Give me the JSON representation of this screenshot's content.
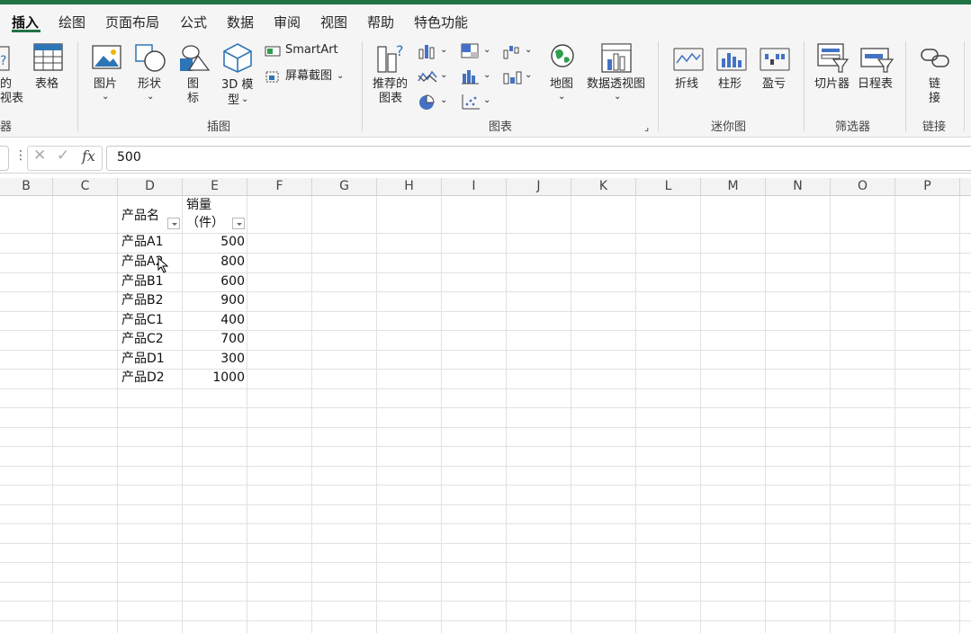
{
  "tabs": [
    "插入",
    "绘图",
    "页面布局",
    "公式",
    "数据",
    "审阅",
    "视图",
    "帮助",
    "特色功能"
  ],
  "ribbon": {
    "partial_left": {
      "line1": "的",
      "line2": "视表"
    },
    "table": "表格",
    "picture": "图片",
    "shapes": "形状",
    "icons_l1": "图",
    "icons_l2": "标",
    "model3d_l1": "3D 模",
    "model3d_l2": "型",
    "smartart": "SmartArt",
    "screenshot": "屏幕截图",
    "recommended_l1": "推荐的",
    "recommended_l2": "图表",
    "map": "地图",
    "pivotchart": "数据透视图",
    "spark_line": "折线",
    "spark_column": "柱形",
    "spark_winloss": "盈亏",
    "slicer": "切片器",
    "timeline": "日程表",
    "link_l1": "链",
    "link_l2": "接",
    "groups": {
      "partial": "器",
      "illustrations": "插图",
      "charts": "图表",
      "sparklines": "迷你图",
      "filters": "筛选器",
      "links": "链接"
    }
  },
  "formula": {
    "fx": "fx",
    "value": "500"
  },
  "columns": [
    "B",
    "C",
    "D",
    "E",
    "F",
    "G",
    "H",
    "I",
    "J",
    "K",
    "L",
    "M",
    "N",
    "O",
    "P"
  ],
  "table": {
    "header_name": "产品名",
    "header_qty_l1": "销量",
    "header_qty_l2": "（件）",
    "rows": [
      {
        "name": "产品A1",
        "qty": "500"
      },
      {
        "name": "产品A2",
        "qty": "800"
      },
      {
        "name": "产品B1",
        "qty": "600"
      },
      {
        "name": "产品B2",
        "qty": "900"
      },
      {
        "name": "产品C1",
        "qty": "400"
      },
      {
        "name": "产品C2",
        "qty": "700"
      },
      {
        "name": "产品D1",
        "qty": "300"
      },
      {
        "name": "产品D2",
        "qty": "1000"
      }
    ]
  },
  "colors": {
    "accent": "#217346",
    "chart_blue": "#4472c4"
  }
}
